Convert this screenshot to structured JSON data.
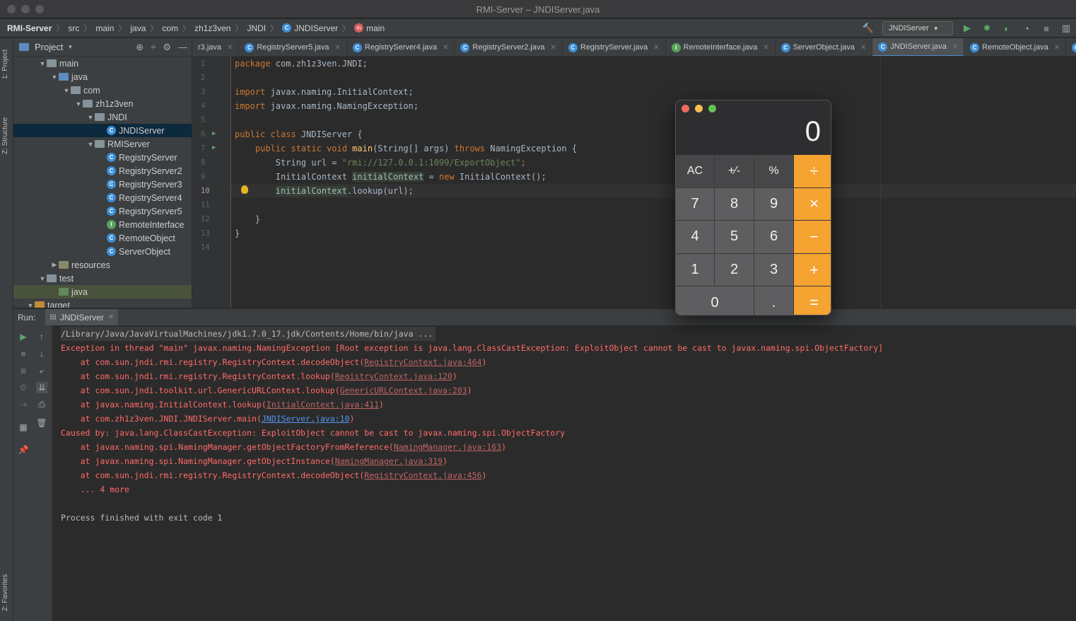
{
  "window": {
    "title": "RMI-Server – JNDIServer.java"
  },
  "breadcrumb": [
    "RMI-Server",
    "src",
    "main",
    "java",
    "com",
    "zh1z3ven",
    "JNDI",
    "JNDIServer",
    "main"
  ],
  "toolbar": {
    "run_config": "JNDIServer"
  },
  "left_strip": {
    "project_tab": "1: Project",
    "structure_tab": "Z: Structure",
    "favorites_tab": "2: Favorites"
  },
  "project": {
    "title": "Project",
    "tree": [
      {
        "label": "main",
        "indent": 1,
        "arrow": "▼",
        "kind": "folder"
      },
      {
        "label": "java",
        "indent": 2,
        "arrow": "▼",
        "kind": "src"
      },
      {
        "label": "com",
        "indent": 3,
        "arrow": "▼",
        "kind": "folder"
      },
      {
        "label": "zh1z3ven",
        "indent": 4,
        "arrow": "▼",
        "kind": "folder"
      },
      {
        "label": "JNDI",
        "indent": 5,
        "arrow": "▼",
        "kind": "folder"
      },
      {
        "label": "JNDIServer",
        "indent": 6,
        "arrow": "",
        "kind": "class",
        "selected": true
      },
      {
        "label": "RMIServer",
        "indent": 5,
        "arrow": "▼",
        "kind": "folder"
      },
      {
        "label": "RegistryServer",
        "indent": 6,
        "arrow": "",
        "kind": "class"
      },
      {
        "label": "RegistryServer2",
        "indent": 6,
        "arrow": "",
        "kind": "class"
      },
      {
        "label": "RegistryServer3",
        "indent": 6,
        "arrow": "",
        "kind": "class"
      },
      {
        "label": "RegistryServer4",
        "indent": 6,
        "arrow": "",
        "kind": "class"
      },
      {
        "label": "RegistryServer5",
        "indent": 6,
        "arrow": "",
        "kind": "class"
      },
      {
        "label": "RemoteInterface",
        "indent": 6,
        "arrow": "",
        "kind": "interface"
      },
      {
        "label": "RemoteObject",
        "indent": 6,
        "arrow": "",
        "kind": "class"
      },
      {
        "label": "ServerObject",
        "indent": 6,
        "arrow": "",
        "kind": "class"
      },
      {
        "label": "resources",
        "indent": 2,
        "arrow": "▶",
        "kind": "res"
      },
      {
        "label": "test",
        "indent": 1,
        "arrow": "▼",
        "kind": "folder"
      },
      {
        "label": "java",
        "indent": 2,
        "arrow": "",
        "kind": "test",
        "testrow": true
      },
      {
        "label": "target",
        "indent": 0,
        "arrow": "▼",
        "kind": "target"
      }
    ]
  },
  "editor_tabs": [
    {
      "label": "r3.java",
      "icon": ""
    },
    {
      "label": "RegistryServer5.java",
      "icon": "c"
    },
    {
      "label": "RegistryServer4.java",
      "icon": "c"
    },
    {
      "label": "RegistryServer2.java",
      "icon": "c"
    },
    {
      "label": "RegistryServer.java",
      "icon": "c"
    },
    {
      "label": "RemoteInterface.java",
      "icon": "i"
    },
    {
      "label": "ServerObject.java",
      "icon": "c"
    },
    {
      "label": "JNDIServer.java",
      "icon": "c",
      "active": true
    },
    {
      "label": "RemoteObject.java",
      "icon": "c"
    },
    {
      "label": "N",
      "icon": "c"
    }
  ],
  "code": {
    "line_numbers": [
      "1",
      "2",
      "3",
      "4",
      "5",
      "6",
      "7",
      "8",
      "9",
      "10",
      "11",
      "12",
      "13",
      "14"
    ],
    "current_line": "10",
    "l1_kw": "package",
    "l1_rest": " com.zh1z3ven.JNDI;",
    "l3_kw": "import",
    "l3_rest": " javax.naming.InitialContext;",
    "l4_kw": "import",
    "l4_rest": " javax.naming.NamingException;",
    "l6_kw": "public class",
    "l6_rest": " JNDIServer {",
    "l7_kw": "    public static void ",
    "l7_fn": "main",
    "l7_mid": "(String[] args) ",
    "l7_kw2": "throws",
    "l7_rest": " NamingException {",
    "l8_a": "        String url = ",
    "l8_str": "\"rmi://127.0.0.1:1099/ExportObject\"",
    "l8_end": ";",
    "l9_a": "        InitialContext ",
    "l9_var": "initialContext",
    "l9_b": " = ",
    "l9_kw": "new",
    "l9_c": " InitialContext();",
    "l10_a": "        ",
    "l10_var": "initialContext",
    "l10_b": ".lookup(url);",
    "l12": "    }",
    "l13": "}"
  },
  "run": {
    "label": "Run:",
    "tab": "JNDIServer",
    "command": "/Library/Java/JavaVirtualMachines/jdk1.7.0_17.jdk/Contents/Home/bin/java ...",
    "e1": "Exception in thread \"main\" javax.naming.NamingException [Root exception is java.lang.ClassCastException: ExploitObject cannot be cast to javax.naming.spi.ObjectFactory]",
    "s1_a": "    at com.sun.jndi.rmi.registry.RegistryContext.decodeObject(",
    "s1_link": "RegistryContext.java:464",
    "s1_b": ")",
    "s2_a": "    at com.sun.jndi.rmi.registry.RegistryContext.lookup(",
    "s2_link": "RegistryContext.java:120",
    "s2_b": ")",
    "s3_a": "    at com.sun.jndi.toolkit.url.GenericURLContext.lookup(",
    "s3_link": "GenericURLContext.java:203",
    "s3_b": ")",
    "s4_a": "    at javax.naming.InitialContext.lookup(",
    "s4_link": "InitialContext.java:411",
    "s4_b": ")",
    "s5_a": "    at com.zh1z3ven.JNDI.JNDIServer.main(",
    "s5_link": "JNDIServer.java:10",
    "s5_b": ")",
    "c1": "Caused by: java.lang.ClassCastException: ExploitObject cannot be cast to javax.naming.spi.ObjectFactory",
    "s6_a": "    at javax.naming.spi.NamingManager.getObjectFactoryFromReference(",
    "s6_link": "NamingManager.java:163",
    "s6_b": ")",
    "s7_a": "    at javax.naming.spi.NamingManager.getObjectInstance(",
    "s7_link": "NamingManager.java:319",
    "s7_b": ")",
    "s8_a": "    at com.sun.jndi.rmi.registry.RegistryContext.decodeObject(",
    "s8_link": "RegistryContext.java:456",
    "s8_b": ")",
    "more": "    ... 4 more",
    "exit": "Process finished with exit code 1"
  },
  "calculator": {
    "display": "0",
    "keys": [
      "AC",
      "+∕-",
      "%",
      "÷",
      "7",
      "8",
      "9",
      "×",
      "4",
      "5",
      "6",
      "−",
      "1",
      "2",
      "3",
      "+",
      "0",
      ".",
      "="
    ]
  },
  "colors": {
    "accent": "#4a88c7",
    "error": "#ff6b68",
    "calc_operator": "#f5a331"
  }
}
